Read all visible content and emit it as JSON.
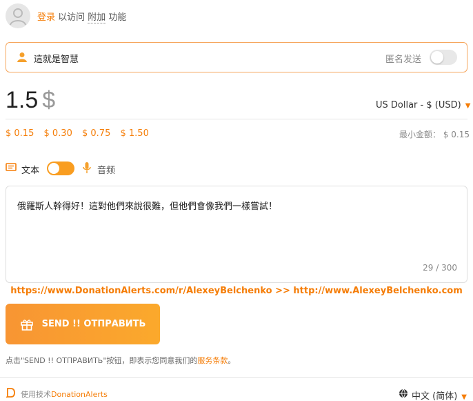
{
  "auth": {
    "login_link": "登录",
    "text_mid": " 以访问 ",
    "extra_link": "附加",
    "text_end": " 功能"
  },
  "donor": {
    "name": "這就是智慧",
    "anonymous_label": "匿名发送",
    "anonymous_enabled": false
  },
  "amount": {
    "value": "1.5",
    "currency_symbol": "$",
    "currency_select": "US Dollar - $ (USD)",
    "presets": [
      "$ 0.15",
      "$ 0.30",
      "$ 0.75",
      "$ 1.50"
    ],
    "min_label": "最小金额： $ 0.15"
  },
  "mode": {
    "text_label": "文本",
    "audio_label": "音频",
    "toggle_on": true
  },
  "message": {
    "text": "俄羅斯人幹得好！這對他們來說很難，但他們會像我們一樣嘗試！",
    "count": "29 / 300"
  },
  "links": {
    "line": "https://www.DonationAlerts.com/r/AlexeyBelchenko  >>  http://www.AlexeyBelchenko.com"
  },
  "send": {
    "label": "SEND !! ОТПРАВИТЬ"
  },
  "terms": {
    "prefix": "点击\"SEND !! ОТПРАВИТЬ\"按钮，即表示您同意我们的",
    "link": "服务条款",
    "suffix": "。"
  },
  "footer": {
    "powered_prefix": "使用技术",
    "powered_brand": "DonationAlerts",
    "language": "中文 (简体)"
  },
  "colors": {
    "accent": "#f57d07",
    "button_start": "#f89533",
    "button_end": "#fba92c"
  }
}
